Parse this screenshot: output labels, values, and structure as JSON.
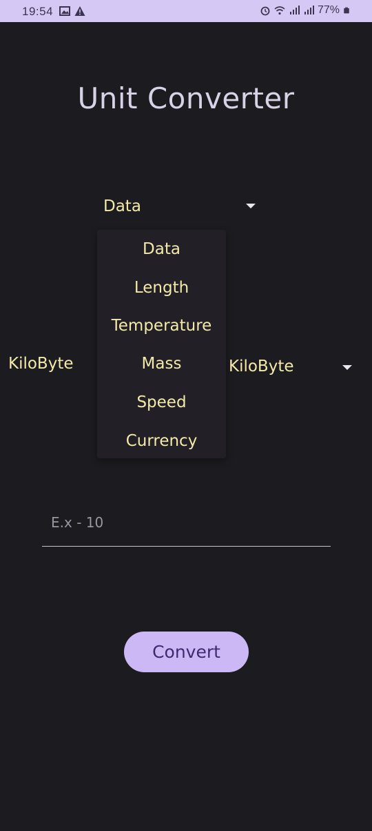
{
  "status_bar": {
    "time": "19:54",
    "battery": "77%",
    "left_icons": [
      "gallery-icon",
      "warning-icon"
    ],
    "right_icons": [
      "alarm-icon",
      "wifi-icon",
      "signal-icon",
      "signal-icon",
      "battery-icon"
    ],
    "colors": {
      "background": "#d6c8f5",
      "foreground": "#3a3450"
    }
  },
  "title": "Unit Converter",
  "category": {
    "selected": "Data",
    "menu_items": [
      "Data",
      "Length",
      "Temperature",
      "Mass",
      "Speed",
      "Currency"
    ]
  },
  "from_unit": {
    "selected": "KiloByte"
  },
  "to_unit": {
    "selected": "KiloByte"
  },
  "input": {
    "placeholder": "E.x - 10",
    "value": ""
  },
  "convert_button": {
    "label": "Convert"
  },
  "colors": {
    "background": "#1c1b1f",
    "text_accent": "#f3e9a9",
    "button": "#cdb8f6",
    "button_text": "#3d2b72",
    "menu_background": "#222026"
  }
}
